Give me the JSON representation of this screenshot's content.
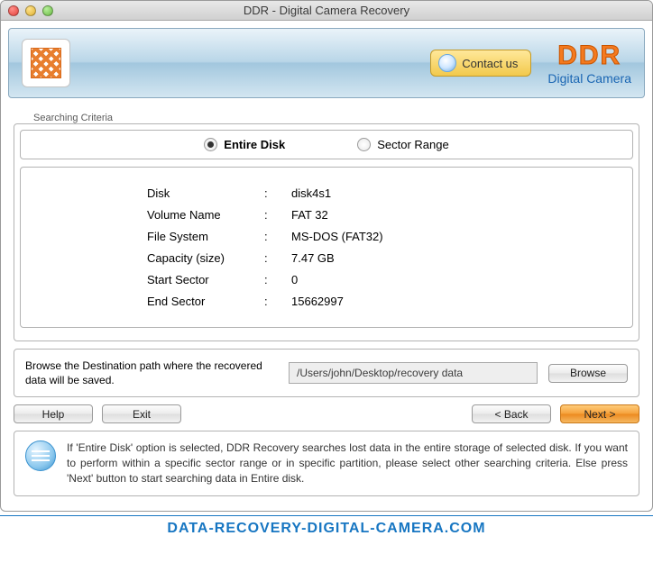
{
  "window": {
    "title": "DDR - Digital Camera Recovery"
  },
  "banner": {
    "contact_label": "Contact us",
    "brand": "DDR",
    "brand_sub": "Digital Camera"
  },
  "criteria": {
    "legend": "Searching Criteria",
    "options": {
      "entire": "Entire Disk",
      "sector": "Sector Range"
    }
  },
  "details": {
    "rows": [
      {
        "key": "Disk",
        "val": "disk4s1"
      },
      {
        "key": "Volume Name",
        "val": "FAT 32"
      },
      {
        "key": "File System",
        "val": "MS-DOS (FAT32)"
      },
      {
        "key": "Capacity (size)",
        "val": "7.47  GB"
      },
      {
        "key": "Start Sector",
        "val": "0"
      },
      {
        "key": "End Sector",
        "val": "15662997"
      }
    ]
  },
  "destination": {
    "label": "Browse the Destination path where the recovered data will be saved.",
    "path": "/Users/john/Desktop/recovery data",
    "browse": "Browse"
  },
  "buttons": {
    "help": "Help",
    "exit": "Exit",
    "back": "< Back",
    "next": "Next >"
  },
  "info": {
    "text": "If 'Entire Disk' option is selected, DDR Recovery searches lost data in the entire storage of selected disk. If you want to perform within a specific sector range or in specific partition, please select other searching criteria. Else press 'Next' button to start searching data in Entire disk."
  },
  "footer_url": "DATA-RECOVERY-DIGITAL-CAMERA.COM"
}
